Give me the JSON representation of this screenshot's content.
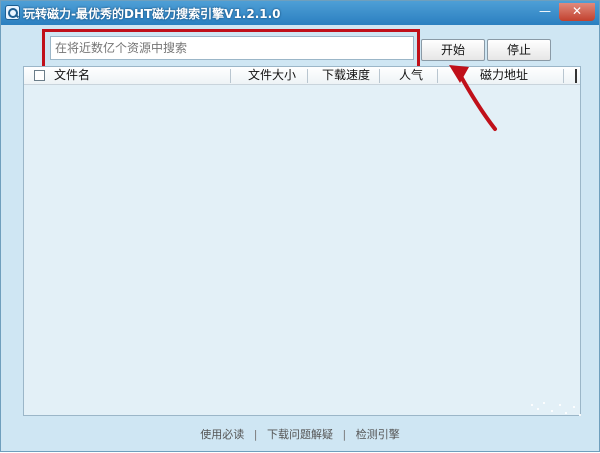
{
  "window": {
    "title": "玩转磁力-最优秀的DHT磁力搜索引擎V1.2.1.0",
    "minimize_glyph": "—",
    "close_glyph": "✕"
  },
  "search": {
    "placeholder": "在将近数亿个资源中搜索",
    "value": ""
  },
  "buttons": {
    "start": "开始",
    "stop": "停止"
  },
  "table": {
    "columns": [
      "文件名",
      "文件大小",
      "下载速度",
      "人气",
      "磁力地址"
    ],
    "rows": []
  },
  "footer": {
    "links": [
      "使用必读",
      "下载问题解疑",
      "检测引擎"
    ],
    "separator": "|"
  },
  "colors": {
    "highlight": "#c0101a",
    "titlebar": "#2b7fc0",
    "background": "#cfe6f3"
  },
  "icons": [
    "magnifier-app-icon",
    "minimize-icon",
    "close-icon",
    "red-arrow-annotation"
  ]
}
